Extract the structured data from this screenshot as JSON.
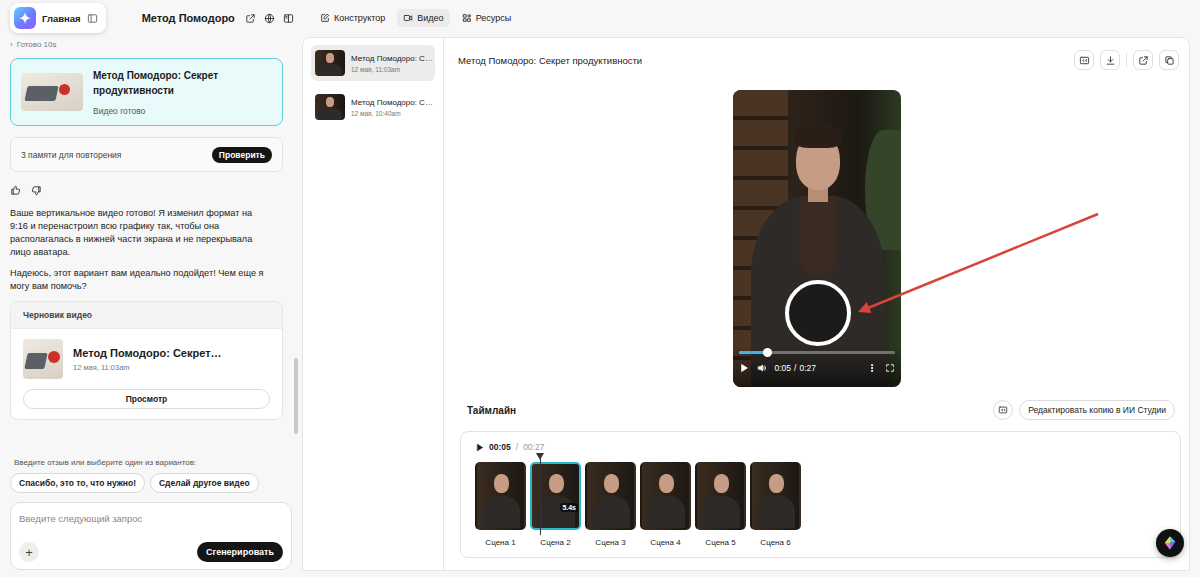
{
  "topbar": {
    "home": "Главная",
    "project": "Метод Помодоро",
    "tabs": [
      {
        "label": "Конструктор",
        "selected": false
      },
      {
        "label": "Видео",
        "selected": true
      },
      {
        "label": "Ресурсы",
        "selected": false
      }
    ]
  },
  "chat": {
    "status": {
      "chevron": "›",
      "text": "Готово 10s"
    },
    "result_card": {
      "title": "Метод Помодоро: Секрет продуктивности",
      "subtitle": "Видео готово",
      "selected": true
    },
    "memory": {
      "text": "3 памяти для повторения",
      "button": "Проверить"
    },
    "message": [
      "Ваше вертикальное видео готово! Я изменил формат на 9:16 и перенастроил всю графику так, чтобы она располагалась в нижней части экрана и не перекрывала лицо аватара.",
      "Надеюсь, этот вариант вам идеально подойдет! Чем еще я могу вам помочь?"
    ],
    "draft": {
      "header": "Черновик видео",
      "title": "Метод Помодоро: Секрет…",
      "date": "12 мая, 11:03am",
      "button": "Просмотр"
    },
    "feedback_prompt": "Введите отзыв или выберите один из вариантов:",
    "suggestions": [
      "Спасибо, это то, что нужно!",
      "Сделай другое видео"
    ],
    "input": {
      "placeholder": "Введите следующий запрос",
      "add": "+",
      "submit": "Сгенерировать"
    }
  },
  "versions": [
    {
      "title": "Метод Помодоро: С…",
      "date": "12 мая, 11:03am",
      "selected": true
    },
    {
      "title": "Метод Помодоро: С…",
      "date": "12 мая, 10:40am",
      "selected": false
    }
  ],
  "video": {
    "title": "Метод Помодоро: Секрет продуктивности",
    "player": {
      "current": "0:05",
      "separator": "/",
      "duration": "0:27",
      "level": 0.185
    }
  },
  "timeline": {
    "title": "Таймлайн",
    "edit_button": "Редактировать копию в ИИ Студии",
    "current": "00:05",
    "separator": "/",
    "duration": "00:27",
    "playhead_level": 0.2,
    "scenes": [
      {
        "label": "Сцена 1",
        "selected": false
      },
      {
        "label": "Сцена 2",
        "selected": true,
        "badge": "5.4s"
      },
      {
        "label": "Сцена 3",
        "selected": false
      },
      {
        "label": "Сцена 4",
        "selected": false
      },
      {
        "label": "Сцена 5",
        "selected": false
      },
      {
        "label": "Сцена 6",
        "selected": false
      }
    ]
  }
}
